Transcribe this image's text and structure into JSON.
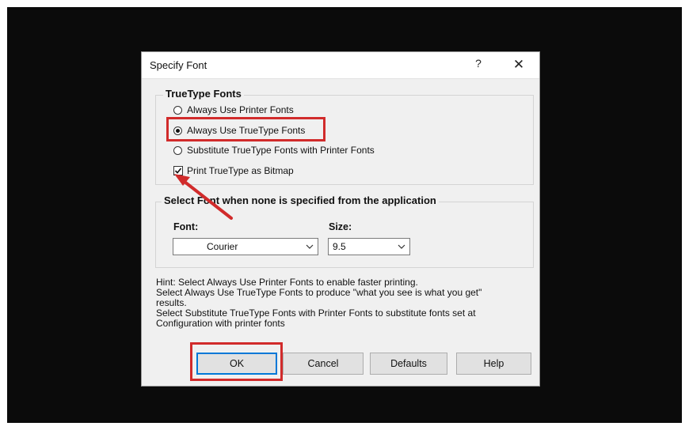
{
  "dialog": {
    "title": "Specify Font",
    "help_label": "?",
    "close_label": "✕"
  },
  "truetype_group": {
    "title": "TrueType Fonts",
    "options": [
      {
        "label": "Always Use Printer Fonts",
        "selected": false
      },
      {
        "label": "Always Use TrueType Fonts",
        "selected": true
      },
      {
        "label": "Substitute TrueType Fonts with Printer Fonts",
        "selected": false
      }
    ],
    "bitmap_checkbox": {
      "label": "Print TrueType as Bitmap",
      "checked": true
    }
  },
  "select_font_group": {
    "title": "Select Font when none is specified from the application",
    "font_label": "Font:",
    "font_value": "Courier",
    "size_label": "Size:",
    "size_value": "9.5"
  },
  "hint_lines": [
    "Hint: Select Always Use Printer Fonts to enable faster printing.",
    "Select Always Use TrueType Fonts to produce \"what you see is what you get\"",
    "results.",
    "Select Substitute TrueType Fonts with Printer Fonts to substitute fonts set at",
    "Configuration with printer fonts"
  ],
  "buttons": {
    "ok": "OK",
    "cancel": "Cancel",
    "defaults": "Defaults",
    "help": "Help"
  },
  "colors": {
    "highlight": "#d12b2b",
    "default_button_border": "#0078d7"
  },
  "icons": [
    "help-icon",
    "close-icon",
    "chevron-down-icon",
    "check-icon",
    "annotation-arrow-icon"
  ]
}
